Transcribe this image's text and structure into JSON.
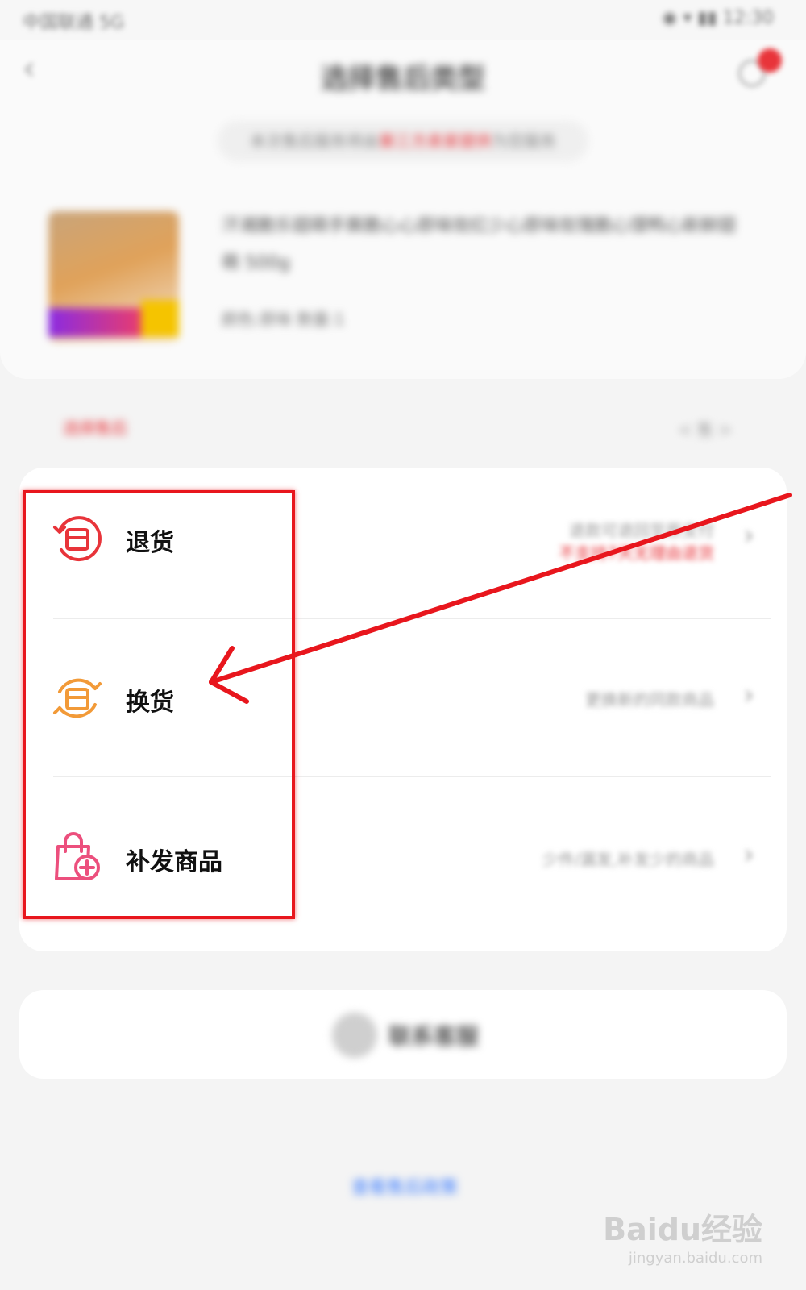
{
  "status_bar": {
    "left": "中国联通 5G",
    "right": "◉ ▾ ▮▮ 12:30"
  },
  "header": {
    "title": "选择售后类型"
  },
  "notice": {
    "before": "本次售后服务将由",
    "highlight": "第三方卖家提供",
    "after": "为您服务"
  },
  "product": {
    "title": "汗湘脆乐翅萌手撕脆心心原味玫红少心原味玫瑰脆心馍鸭心新鲜翅萌 500g",
    "spec": "颜色:原味  数量:1"
  },
  "section": {
    "label": "选择售后",
    "right": "< 售 >"
  },
  "options": [
    {
      "label": "退货",
      "desc_top": "退款可退回至原支付",
      "desc_bottom": "不支持7天无理由退货"
    },
    {
      "label": "换货",
      "desc_top": "更换新的同款商品",
      "desc_bottom": ""
    },
    {
      "label": "补发商品",
      "desc_top": "少件/漏发,补发少的商品",
      "desc_bottom": ""
    }
  ],
  "chevron_glyph": "›",
  "back_glyph": "‹",
  "bottom": {
    "text": "联系客服"
  },
  "footer_link": "查看售后政策",
  "watermark": {
    "text": "Baidu经验",
    "sub": "jingyan.baidu.com"
  },
  "colors": {
    "accent_red": "#e8343a",
    "highlight_red": "#e8161d",
    "exchange_orange": "#f29a38",
    "reissue_pink": "#ec4f7d"
  },
  "icons": {
    "return": "return-box-icon",
    "exchange": "exchange-box-icon",
    "reissue": "shopping-bag-plus-icon"
  }
}
